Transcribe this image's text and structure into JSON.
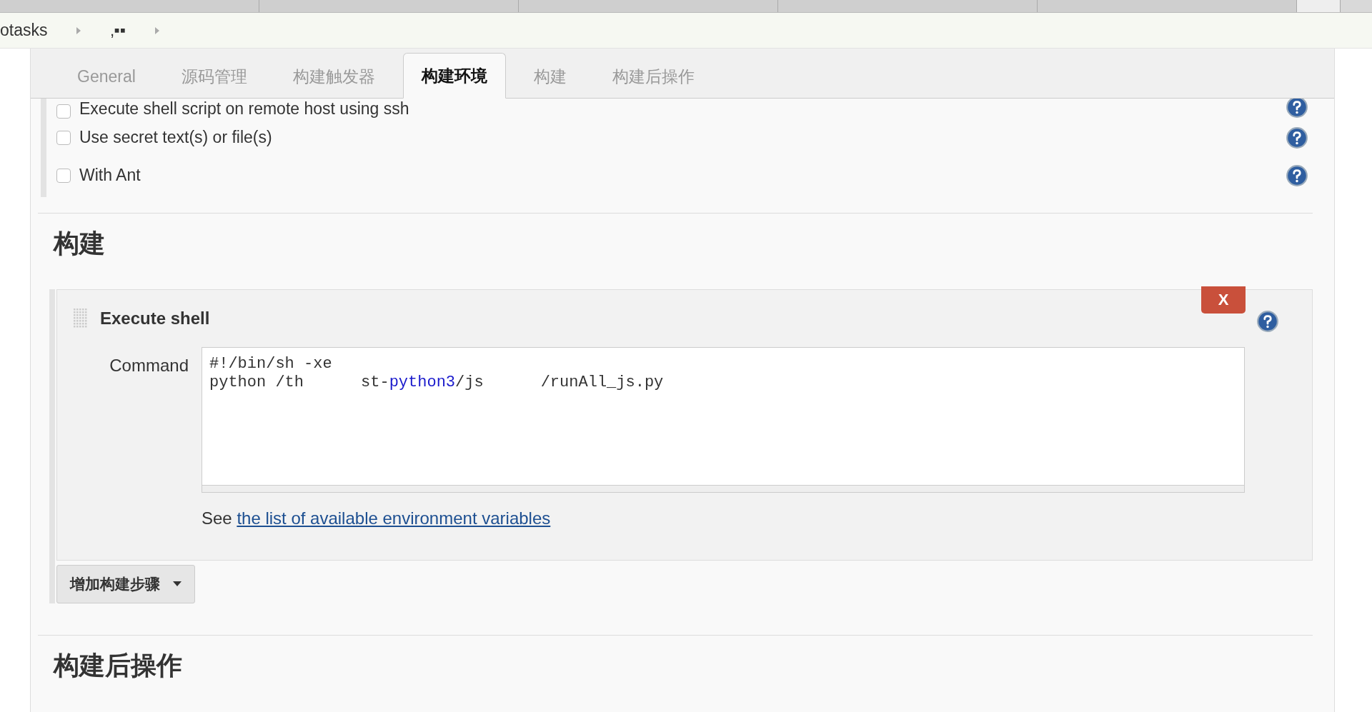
{
  "browser_tabs": [
    {
      "selected": false
    },
    {
      "selected": false
    },
    {
      "selected": false
    },
    {
      "selected": false
    },
    {
      "selected": false
    },
    {
      "selected": true
    }
  ],
  "breadcrumb": [
    "otasks",
    "‚▪▪"
  ],
  "tabs": [
    {
      "label": "General",
      "selected": false
    },
    {
      "label": "源码管理",
      "selected": false
    },
    {
      "label": "构建触发器",
      "selected": false
    },
    {
      "label": "构建环境",
      "selected": true
    },
    {
      "label": "构建",
      "selected": false
    },
    {
      "label": "构建后操作",
      "selected": false
    }
  ],
  "env_options": [
    {
      "label": "Execute shell script on remote host using ssh",
      "checked": false
    },
    {
      "label": "Use secret text(s) or file(s)",
      "checked": false
    },
    {
      "label": "With Ant",
      "checked": false
    }
  ],
  "build_section": {
    "title": "构建",
    "step": {
      "title": "Execute shell",
      "delete": "X",
      "command_label": "Command",
      "command_lines": [
        [
          {
            "text": "#!/bin/sh -xe",
            "kind": "plain"
          }
        ],
        [
          {
            "text": "python /th",
            "kind": "plain"
          },
          {
            "text": "st-",
            "kind": "plain",
            "gap_before": true
          },
          {
            "text": "python3",
            "kind": "keyword"
          },
          {
            "text": "/js",
            "kind": "plain"
          },
          {
            "text": "/runAll_js.py",
            "kind": "plain",
            "gap_before": true
          }
        ]
      ],
      "hint": "See",
      "link": "the list of available environment variables"
    },
    "add_button": "增加构建步骤"
  },
  "post_section": {
    "title": "构建后操作"
  }
}
